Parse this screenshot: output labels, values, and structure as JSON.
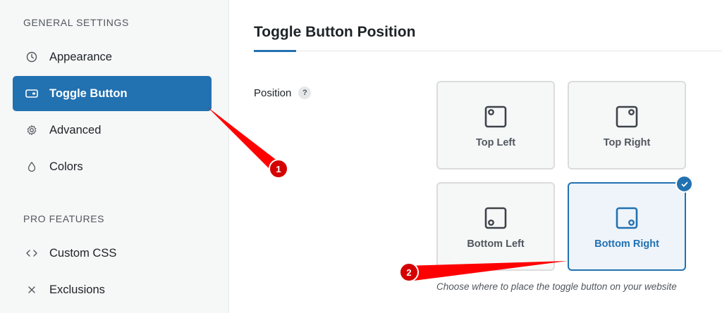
{
  "sidebar": {
    "general_title": "GENERAL SETTINGS",
    "pro_title": "PRO FEATURES",
    "items": [
      {
        "label": "Appearance",
        "icon": "clock-icon"
      },
      {
        "label": "Toggle Button",
        "icon": "toggle-card-icon"
      },
      {
        "label": "Advanced",
        "icon": "gear-icon"
      },
      {
        "label": "Colors",
        "icon": "droplet-icon"
      }
    ],
    "pro_items": [
      {
        "label": "Custom CSS",
        "icon": "code-icon"
      },
      {
        "label": "Exclusions",
        "icon": "close-icon"
      }
    ],
    "active_item": "Toggle Button"
  },
  "main": {
    "title": "Toggle Button Position",
    "field_label": "Position",
    "help_badge": "?",
    "options": [
      {
        "label": "Top Left"
      },
      {
        "label": "Top Right"
      },
      {
        "label": "Bottom Left"
      },
      {
        "label": "Bottom Right"
      }
    ],
    "selected_option": "Bottom Right",
    "help_text": "Choose where to place the toggle button on your website"
  },
  "annotations": [
    {
      "label": "1"
    },
    {
      "label": "2"
    }
  ],
  "colors": {
    "accent": "#2271b1",
    "annotation": "#ff0000"
  }
}
